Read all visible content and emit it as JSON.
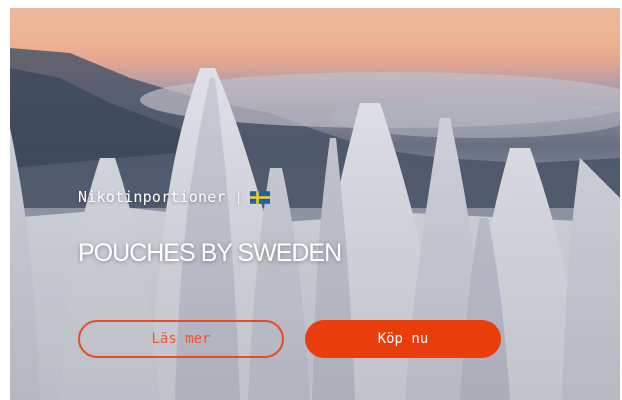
{
  "hero": {
    "tagline": "Nikotinportioner",
    "separator": "|",
    "flag": "swedish-flag-icon",
    "headline": "POUCHES BY SWEDEN"
  },
  "buttons": {
    "read_more": "Läs mer",
    "buy_now": "Köp nu"
  },
  "colors": {
    "accent": "#ea3d0c",
    "outline": "#e94a25",
    "text_on_image": "#ffffff",
    "flag_blue": "#1f5fae",
    "flag_yellow": "#f8cf1a"
  }
}
